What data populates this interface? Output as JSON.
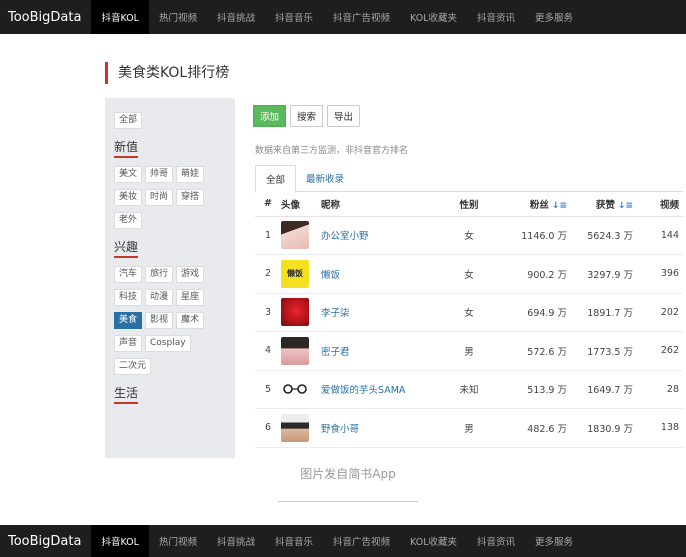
{
  "nav": {
    "brand": "TooBigData",
    "items": [
      "抖音KOL",
      "热门视频",
      "抖音挑战",
      "抖音音乐",
      "抖音广告视频",
      "KOL收藏夹",
      "抖音资讯",
      "更多服务"
    ]
  },
  "page": {
    "title": "美食类KOL排行榜"
  },
  "sidebar": {
    "all_label": "全部",
    "groups": [
      {
        "title": "新值",
        "tags": [
          [
            "美文",
            "帅哥",
            "萌娃"
          ],
          [
            "美妆",
            "时尚",
            "穿搭"
          ],
          [
            "老外"
          ]
        ]
      },
      {
        "title": "兴趣",
        "tags": [
          [
            "汽车",
            "旅行",
            "游戏"
          ],
          [
            "科技",
            "动漫",
            "星座"
          ],
          [
            "美食",
            "影视",
            "魔术"
          ],
          [
            "声音",
            "Cosplay"
          ],
          [
            "二次元"
          ]
        ]
      },
      {
        "title": "生活"
      }
    ],
    "selected": "美食"
  },
  "toolbar": {
    "add": "添加",
    "search": "搜索",
    "export": "导出"
  },
  "notice": "数据来自第三方监测，非抖音官方排名",
  "tabs": [
    "全部",
    "最新收录"
  ],
  "table": {
    "headers": {
      "rank": "#",
      "avatar": "头像",
      "nickname": "昵称",
      "gender": "性别",
      "fans": "粉丝",
      "likes": "获赞",
      "videos": "视频"
    },
    "rows": [
      {
        "rank": "1",
        "nickname": "办公室小野",
        "gender": "女",
        "fans": "1146.0 万",
        "likes": "5624.3 万",
        "videos": "144"
      },
      {
        "rank": "2",
        "nickname": "懒饭",
        "gender": "女",
        "fans": "900.2 万",
        "likes": "3297.9 万",
        "videos": "396",
        "avatar_text": "懒饭"
      },
      {
        "rank": "3",
        "nickname": "李子柒",
        "gender": "女",
        "fans": "694.9 万",
        "likes": "1891.7 万",
        "videos": "202"
      },
      {
        "rank": "4",
        "nickname": "密子君",
        "gender": "男",
        "fans": "572.6 万",
        "likes": "1773.5 万",
        "videos": "262"
      },
      {
        "rank": "5",
        "nickname": "爱做饭的芋头SAMA",
        "gender": "未知",
        "fans": "513.9 万",
        "likes": "1649.7 万",
        "videos": "28"
      },
      {
        "rank": "6",
        "nickname": "野食小哥",
        "gender": "男",
        "fans": "482.6 万",
        "likes": "1830.9 万",
        "videos": "138"
      }
    ]
  },
  "caption": "图片发自简书App",
  "colors": {
    "accent": "#c0392b",
    "link": "#2a6fa5",
    "primary_button": "#5cb85c",
    "navbar": "#1e1e1e"
  }
}
